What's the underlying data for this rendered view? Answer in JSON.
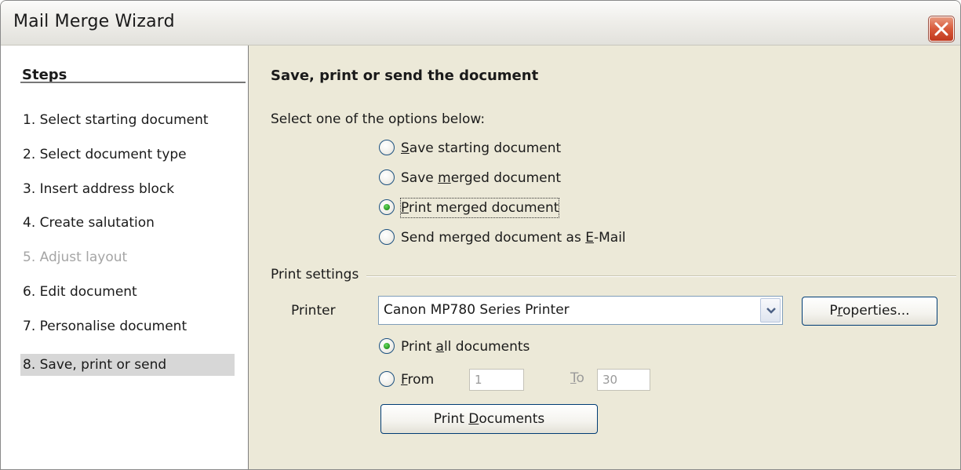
{
  "window": {
    "title": "Mail Merge Wizard",
    "close_icon": "close-icon"
  },
  "steps": {
    "heading": "Steps",
    "items": [
      {
        "label": "1.  Select starting document",
        "state": "enabled"
      },
      {
        "label": "2.  Select document type",
        "state": "enabled"
      },
      {
        "label": "3.  Insert address block",
        "state": "enabled"
      },
      {
        "label": "4.  Create salutation",
        "state": "enabled"
      },
      {
        "label": "5.  Adjust layout",
        "state": "disabled"
      },
      {
        "label": "6.  Edit document",
        "state": "enabled"
      },
      {
        "label": "7.  Personalise document",
        "state": "enabled"
      },
      {
        "label": "8.  Save, print or send",
        "state": "selected"
      }
    ]
  },
  "page": {
    "heading": "Save, print or send the document",
    "instructions": "Select one of the options below:",
    "options": [
      {
        "before": "",
        "mnemonic": "S",
        "after": "ave starting document",
        "checked": false
      },
      {
        "before": "Save ",
        "mnemonic": "m",
        "after": "erged document",
        "checked": false
      },
      {
        "before": "",
        "mnemonic": "P",
        "after": "rint merged document",
        "checked": true
      },
      {
        "before": "Send merged document as ",
        "mnemonic": "E",
        "after": "-Mail",
        "checked": false
      }
    ]
  },
  "print_settings": {
    "group_label": "Print settings",
    "printer_label": "Printer",
    "printer_value": "Canon MP780 Series Printer",
    "properties_button": {
      "before": "P",
      "mnemonic": "r",
      "after": "operties..."
    },
    "print_all": {
      "before": "Print ",
      "mnemonic": "a",
      "after": "ll documents",
      "checked": true
    },
    "from": {
      "before": "",
      "mnemonic": "F",
      "after": "rom",
      "checked": false,
      "value": "1"
    },
    "to": {
      "before": "",
      "mnemonic": "T",
      "after": "o",
      "value": "30"
    },
    "print_documents_button": {
      "before": "Print ",
      "mnemonic": "D",
      "after": "ocuments"
    }
  },
  "colors": {
    "dialog_bg": "#ece9d8",
    "radio_dot": "#2f9f27",
    "close_button": "#d8593a",
    "selected_step_bg": "#d7d7d7",
    "disabled_text": "#a5a5a5"
  }
}
